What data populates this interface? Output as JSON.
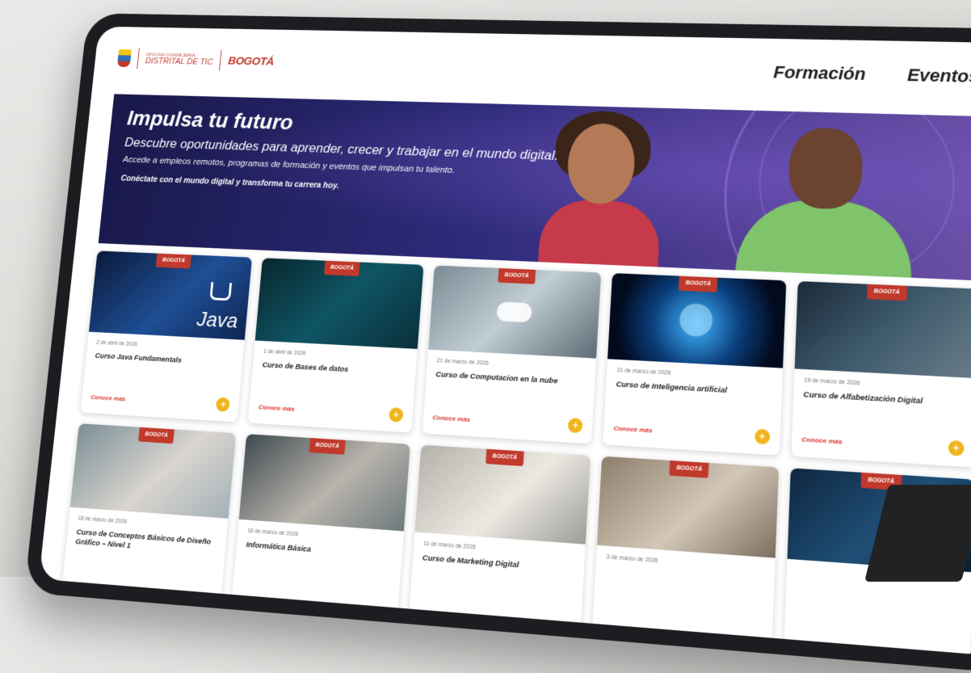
{
  "header": {
    "logo_small": "OFICINA CONSEJERÍA",
    "logo_main": "DISTRITAL DE TIC",
    "bogota": "BOGOTÁ",
    "nav": [
      "Formación",
      "Eventos"
    ]
  },
  "hero": {
    "title": "Impulsa tu futuro",
    "subtitle": "Descubre oportunidades para aprender, crecer y trabajar en el mundo digital.",
    "description": "Accede a empleos remotos, programas de formación y eventos que impulsan tu talento.",
    "cta_text": "Conéctate con el mundo digital y transforma tu carrera hoy."
  },
  "cards": [
    {
      "tag": "BOGOTÁ",
      "date": "2 de abril de 2026",
      "title": "Curso Java Fundamentals",
      "link": "Conoce más",
      "image_icon": "java-logo-icon"
    },
    {
      "tag": "BOGOTÁ",
      "date": "1 de abril de 2026",
      "title": "Curso de Bases de datos",
      "link": "Conoce más",
      "image_icon": "database-icon"
    },
    {
      "tag": "BOGOTÁ",
      "date": "21 de marzo de 2026",
      "title": "Curso de Computacion en la nube",
      "link": "Conoce más",
      "image_icon": "cloud-icon"
    },
    {
      "tag": "BOGOTÁ",
      "date": "21 de marzo de 2026",
      "title": "Curso de Inteligencia artificial",
      "link": "Conoce más",
      "image_icon": "brain-icon"
    },
    {
      "tag": "BOGOTÁ",
      "date": "19 de marzo de 2026",
      "title": "Curso de Alfabetización Digital",
      "link": "Conoce más",
      "image_icon": "apps-icon"
    },
    {
      "tag": "BOGOTÁ",
      "date": "18 de marzo de 2026",
      "title": "Curso de Conceptos Básicos de Diseño Gráfico – Nivel 1",
      "link": "",
      "image_icon": "design-icon"
    },
    {
      "tag": "BOGOTÁ",
      "date": "16 de marzo de 2026",
      "title": "Informática Básica",
      "link": "",
      "image_icon": "computer-icon"
    },
    {
      "tag": "BOGOTÁ",
      "date": "11 de marzo de 2026",
      "title": "Curso de Marketing Digital",
      "link": "",
      "image_icon": "chart-icon"
    },
    {
      "tag": "BOGOTÁ",
      "date": "3 de marzo de 2026",
      "title": "",
      "link": "",
      "image_icon": "tablet-icon"
    },
    {
      "tag": "BOGOTÁ",
      "date": "",
      "title": "",
      "link": "",
      "image_icon": "code-icon"
    }
  ],
  "colors": {
    "accent": "#c0392b",
    "plus": "#f1b51c"
  }
}
